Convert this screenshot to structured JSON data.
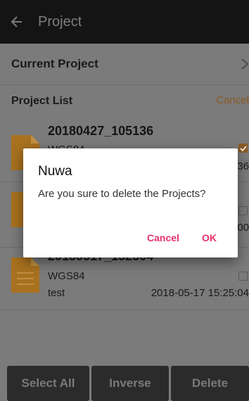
{
  "topbar": {
    "title": "Project"
  },
  "current_project": {
    "label": "Current Project"
  },
  "project_list": {
    "label": "Project List",
    "cancel_label": "Cancel",
    "items": [
      {
        "name": "20180427_105136",
        "coord": "WGS84",
        "user": "",
        "date": "36",
        "checked": true
      },
      {
        "name": "",
        "coord": "",
        "user": "",
        "date": "00",
        "checked": false
      },
      {
        "name": "20180517_152504",
        "coord": "WGS84",
        "user": "test",
        "date": "2018-05-17 15:25:04",
        "checked": false
      }
    ]
  },
  "bottom": {
    "select_all": "Select All",
    "inverse": "Inverse",
    "delete": "Delete"
  },
  "dialog": {
    "title": "Nuwa",
    "message": "Are you sure to delete the Projects?",
    "cancel": "Cancel",
    "ok": "OK"
  },
  "colors": {
    "accent": "#e8326a",
    "topbar": "#141414",
    "file_icon": "#a8711f"
  },
  "icons": {
    "back": "arrow-left-icon",
    "chevron": "chevron-right-icon",
    "file": "document-icon",
    "check": "check-icon"
  }
}
